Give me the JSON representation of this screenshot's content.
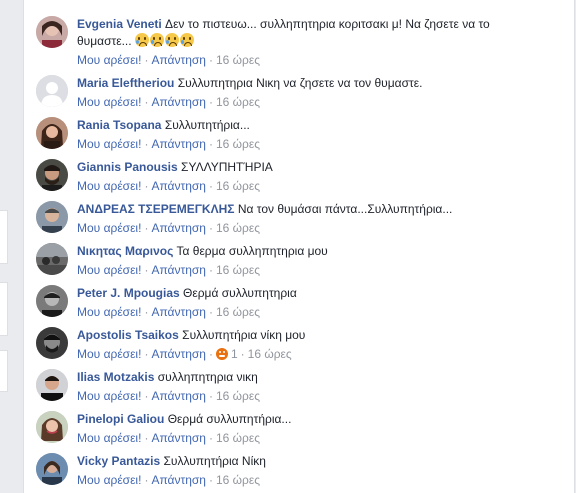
{
  "comments": [
    {
      "author": "Evgenia Veneti",
      "text_line1": "Δεν το πιστευω... συλληπητηρια κοριτσακι μ! Να ζησετε να το",
      "text_line2": "θυμαστε...",
      "like": "Μου αρέσει!",
      "reply": "Απάντηση",
      "time": "16 ώρες",
      "emojis": [
        "crying-face",
        "crying-face",
        "crying-face",
        "crying-face"
      ]
    },
    {
      "author": "Maria Eleftheriou",
      "text": "Συλλυπητηρια Νικη να ζησετε να τον θυμαστε.",
      "like": "Μου αρέσει!",
      "reply": "Απάντηση",
      "time": "16 ώρες"
    },
    {
      "author": "Rania Tsopana",
      "text": "Συλλυπητήρια...",
      "like": "Μου αρέσει!",
      "reply": "Απάντηση",
      "time": "16 ώρες"
    },
    {
      "author": "Giannis Panousis",
      "text": "ΣΥΛΛΥΠΗΤΉΡΙΑ",
      "like": "Μου αρέσει!",
      "reply": "Απάντηση",
      "time": "16 ώρες"
    },
    {
      "author": "ΑΝΔΡΕΑΣ ΤΣΕΡΕΜΕΓΚΛΗΣ",
      "text": "Να τον θυμάσαι πάντα...Συλλυπητήρια...",
      "like": "Μου αρέσει!",
      "reply": "Απάντηση",
      "time": "16 ώρες"
    },
    {
      "author": "Νικητας Μαρινος",
      "text": "Τα θερμα συλληπητηρια μου",
      "like": "Μου αρέσει!",
      "reply": "Απάντηση",
      "time": "16 ώρες"
    },
    {
      "author": "Peter J. Mpougias",
      "text": "Θερμά συλλυπητηρια",
      "like": "Μου αρέσει!",
      "reply": "Απάντηση",
      "time": "16 ώρες"
    },
    {
      "author": "Apostolis Tsaikos",
      "text": "Συλλυπητήρια νίκη μου",
      "like": "Μου αρέσει!",
      "reply": "Απάντηση",
      "reaction_count": "1",
      "time": "16 ώρες"
    },
    {
      "author": "Ilias Motzakis",
      "text": "συλληπητηρια νικη",
      "like": "Μου αρέσει!",
      "reply": "Απάντηση",
      "time": "16 ώρες"
    },
    {
      "author": "Pinelopi Galiou",
      "text": "Θερμά συλλυπητήρια...",
      "like": "Μου αρέσει!",
      "reply": "Απάντηση",
      "time": "16 ώρες"
    },
    {
      "author": "Vicky Pantazis",
      "text": "Συλλυπητήρια Νίκη",
      "like": "Μου αρέσει!",
      "reply": "Απάντηση",
      "time": "16 ώρες"
    }
  ],
  "colors": {
    "author": "#385898",
    "link": "#4267b2",
    "meta": "#90949c",
    "background": "#e9ebee"
  }
}
